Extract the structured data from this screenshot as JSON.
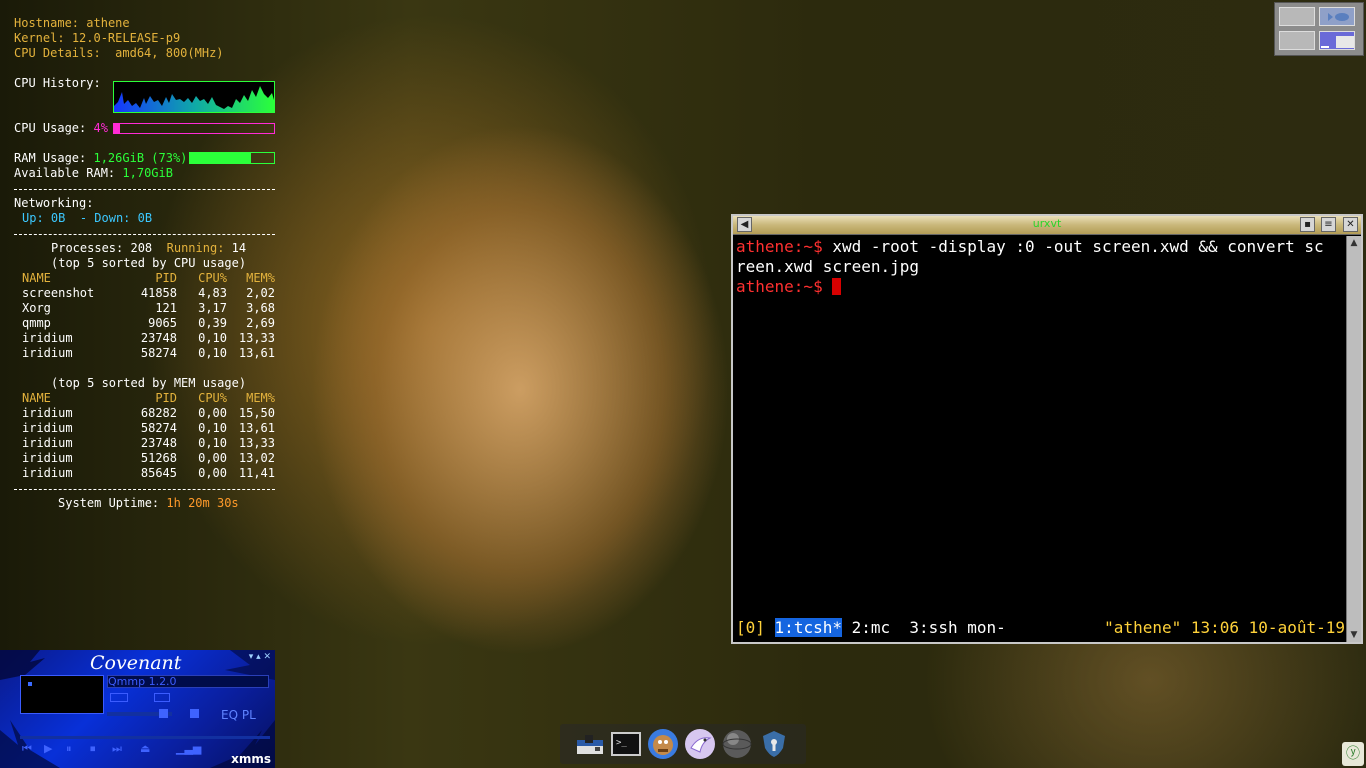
{
  "conky": {
    "hostname_label": "Hostname:",
    "hostname": "athene",
    "kernel_label": "Kernel:",
    "kernel": "12.0-RELEASE-p9",
    "cpu_details_label": "CPU Details:",
    "cpu_details": "amd64, 800(MHz)",
    "cpu_history_label": "CPU History:",
    "cpu_usage_label": "CPU Usage:",
    "cpu_usage": "4%",
    "cpu_usage_fraction": 0.04,
    "ram_usage_label": "RAM Usage:",
    "ram_usage": "1,26GiB (73%)",
    "ram_usage_fraction": 0.73,
    "available_ram_label": "Available RAM:",
    "available_ram": "1,70GiB",
    "separator": "----------------------------------",
    "networking_label": "Networking:",
    "network_up": "Up: 0B",
    "network_sep": "-",
    "network_down": "Down: 0B",
    "processes_label": "Processes:",
    "processes": "208",
    "running_label": "Running:",
    "running": "14",
    "cpu_sort_heading": "(top 5 sorted by CPU usage)",
    "mem_sort_heading": "(top 5 sorted by MEM usage)",
    "columns": [
      "NAME",
      "PID",
      "CPU%",
      "MEM%"
    ],
    "top_cpu": [
      {
        "name": "screenshot",
        "pid": "41858",
        "cpu": "4,83",
        "mem": "2,02"
      },
      {
        "name": "Xorg",
        "pid": "121",
        "cpu": "3,17",
        "mem": "3,68"
      },
      {
        "name": "qmmp",
        "pid": "9065",
        "cpu": "0,39",
        "mem": "2,69"
      },
      {
        "name": "iridium",
        "pid": "23748",
        "cpu": "0,10",
        "mem": "13,33"
      },
      {
        "name": "iridium",
        "pid": "58274",
        "cpu": "0,10",
        "mem": "13,61"
      }
    ],
    "top_mem": [
      {
        "name": "iridium",
        "pid": "68282",
        "cpu": "0,00",
        "mem": "15,50"
      },
      {
        "name": "iridium",
        "pid": "58274",
        "cpu": "0,10",
        "mem": "13,61"
      },
      {
        "name": "iridium",
        "pid": "23748",
        "cpu": "0,10",
        "mem": "13,33"
      },
      {
        "name": "iridium",
        "pid": "51268",
        "cpu": "0,00",
        "mem": "13,02"
      },
      {
        "name": "iridium",
        "pid": "85645",
        "cpu": "0,00",
        "mem": "11,41"
      }
    ],
    "uptime_label": "System Uptime:",
    "uptime": "1h 20m 30s"
  },
  "terminal": {
    "title": "urxvt",
    "prompt": "athene:~$",
    "command_line_1": " xwd -root -display :0 -out screen.xwd && convert sc",
    "command_line_2": "reen.xwd screen.jpg",
    "status_window0": "[0]",
    "status_active_window": "1:tcsh*",
    "status_windows": " 2:mc  3:ssh mon-",
    "status_right": "\"athene\" 13:06 10-août-19"
  },
  "xmms": {
    "skin_title": "Covenant",
    "song": "Qmmp 1.2.0",
    "eq_label": "EQ",
    "pl_label": "PL",
    "brand": "xmms",
    "window_controls": "▾ ▴ ✕"
  },
  "dock": {
    "icons": [
      "files-icon",
      "terminal-icon",
      "gimp-icon",
      "browser-icon",
      "network-globe-icon",
      "security-shield-icon"
    ]
  },
  "tray": {
    "icon": "update-notifier-icon"
  },
  "colors": {
    "conky_label": "#e3b23c",
    "cpu_accent": "#ff2bd6",
    "ram_accent": "#2bff3a",
    "network_accent": "#3cc8ff",
    "uptime_accent": "#ff9a2a",
    "terminal_prompt": "#ff3030",
    "terminal_status": "#ffd23a",
    "xmms_blue": "#0830d8"
  }
}
